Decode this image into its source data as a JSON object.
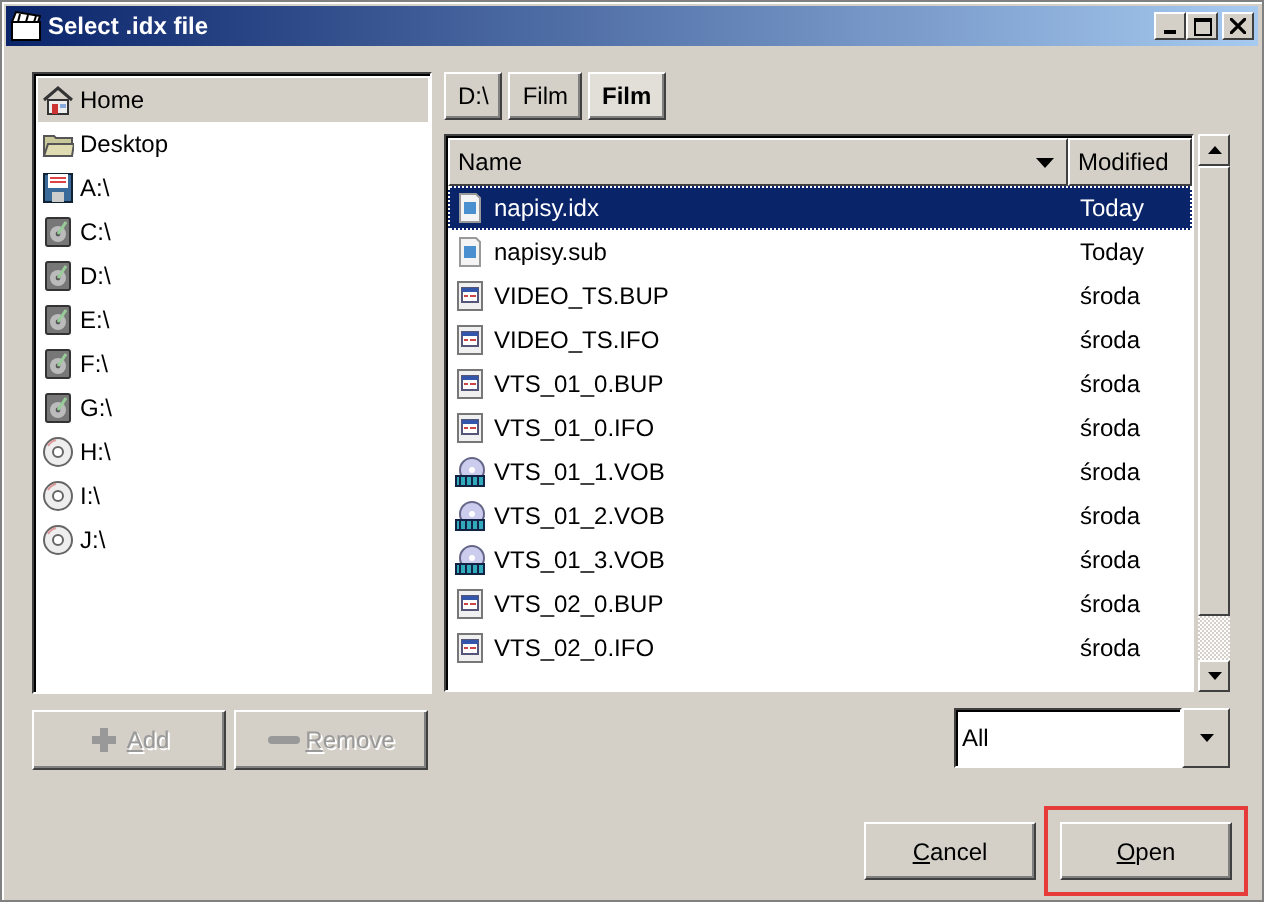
{
  "window": {
    "title": "Select .idx file"
  },
  "places": [
    {
      "label": "Home",
      "kind": "home",
      "selected": true
    },
    {
      "label": "Desktop",
      "kind": "folder",
      "selected": false
    },
    {
      "label": "A:\\",
      "kind": "floppy",
      "selected": false
    },
    {
      "label": "C:\\",
      "kind": "disk",
      "selected": false
    },
    {
      "label": "D:\\",
      "kind": "disk",
      "selected": false
    },
    {
      "label": "E:\\",
      "kind": "disk",
      "selected": false
    },
    {
      "label": "F:\\",
      "kind": "disk",
      "selected": false
    },
    {
      "label": "G:\\",
      "kind": "disk",
      "selected": false
    },
    {
      "label": "H:\\",
      "kind": "cd",
      "selected": false
    },
    {
      "label": "I:\\",
      "kind": "cd",
      "selected": false
    },
    {
      "label": "J:\\",
      "kind": "cd",
      "selected": false
    }
  ],
  "path": [
    {
      "label": "D:\\",
      "selected": false
    },
    {
      "label": "Film",
      "selected": false
    },
    {
      "label": "Film",
      "selected": true
    }
  ],
  "table": {
    "columns": [
      "Name",
      "Modified"
    ],
    "rows": [
      {
        "name": "napisy.idx",
        "modified": "Today",
        "kind": "subtitle",
        "selected": true
      },
      {
        "name": "napisy.sub",
        "modified": "Today",
        "kind": "subtitle",
        "selected": false
      },
      {
        "name": "VIDEO_TS.BUP",
        "modified": "środa",
        "kind": "info",
        "selected": false
      },
      {
        "name": "VIDEO_TS.IFO",
        "modified": "środa",
        "kind": "info",
        "selected": false
      },
      {
        "name": "VTS_01_0.BUP",
        "modified": "środa",
        "kind": "info",
        "selected": false
      },
      {
        "name": "VTS_01_0.IFO",
        "modified": "środa",
        "kind": "info",
        "selected": false
      },
      {
        "name": "VTS_01_1.VOB",
        "modified": "środa",
        "kind": "video",
        "selected": false
      },
      {
        "name": "VTS_01_2.VOB",
        "modified": "środa",
        "kind": "video",
        "selected": false
      },
      {
        "name": "VTS_01_3.VOB",
        "modified": "środa",
        "kind": "video",
        "selected": false
      },
      {
        "name": "VTS_02_0.BUP",
        "modified": "środa",
        "kind": "info",
        "selected": false
      },
      {
        "name": "VTS_02_0.IFO",
        "modified": "środa",
        "kind": "info",
        "selected": false
      }
    ]
  },
  "place_buttons": [
    {
      "label": "Add",
      "kind": "add",
      "disabled": true
    },
    {
      "label": "Remove",
      "kind": "remove",
      "disabled": true
    }
  ],
  "filter": {
    "value": "All"
  },
  "buttons": [
    {
      "label": "Cancel",
      "highlighted": false
    },
    {
      "label": "Open",
      "highlighted": true
    }
  ]
}
